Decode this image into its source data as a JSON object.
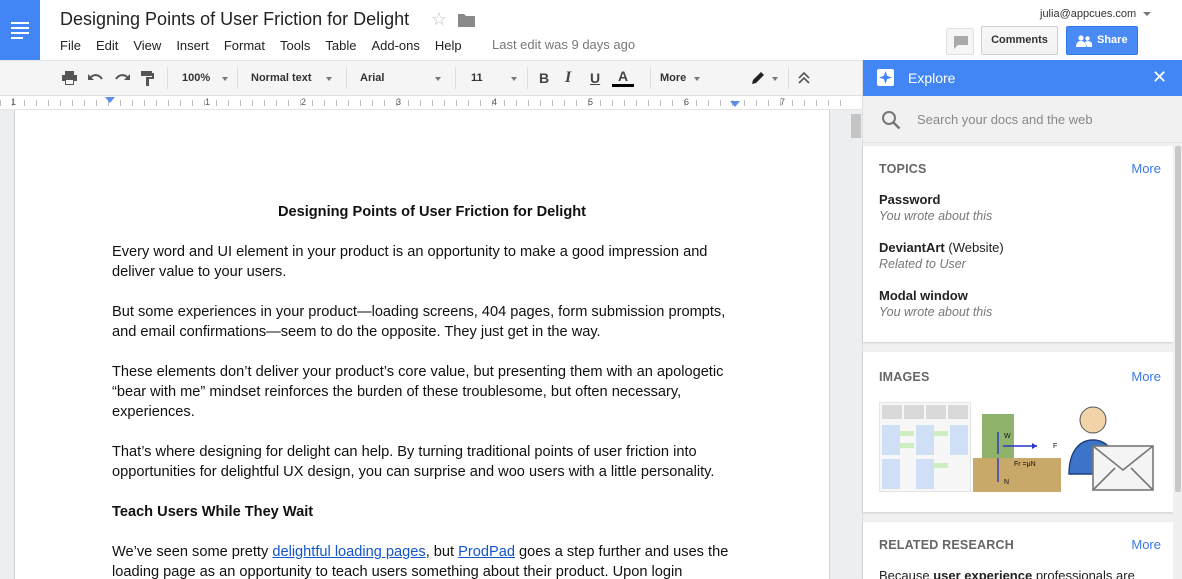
{
  "app": {
    "doc_title": "Designing Points of User Friction for Delight",
    "account": "julia@appcues.com",
    "last_edit": "Last edit was 9 days ago",
    "menu": [
      "File",
      "Edit",
      "View",
      "Insert",
      "Format",
      "Tools",
      "Table",
      "Add-ons",
      "Help"
    ],
    "comments_label": "Comments",
    "share_label": "Share"
  },
  "toolbar": {
    "zoom": "100%",
    "style": "Normal text",
    "font": "Arial",
    "size": "11",
    "bold": "B",
    "italic": "I",
    "underline": "U",
    "text_color": "A",
    "more": "More"
  },
  "ruler": {
    "numbers": [
      "1",
      "1",
      "2",
      "3",
      "4",
      "5",
      "6",
      "7"
    ]
  },
  "document": {
    "heading": "Designing Points of User Friction for Delight",
    "paragraphs": [
      "Every word and UI element in your product is an opportunity to make a good impression and deliver value to your users.",
      "But some experiences in your product—loading screens, 404 pages, form submission prompts, and email confirmations—seem to do the opposite. They just get in the way.",
      "These elements don’t deliver your product’s core value, but presenting them with an apologetic “bear with me” mindset reinforces the burden of these troublesome, but often necessary, experiences.",
      "That’s where designing for delight can help. By turning traditional points of user friction into opportunities for delightful UX design, you can surprise and woo users with a little personality."
    ],
    "subheading": "Teach Users While They Wait",
    "last_para": {
      "pre": "We’ve seen some pretty ",
      "link1": "delightful loading pages",
      "mid": ", but ",
      "link2": "ProdPad",
      "post": " goes a step further and uses the loading page as an opportunity to teach users something about their product. Upon login"
    }
  },
  "explore": {
    "title": "Explore",
    "search_placeholder": "Search your docs and the web",
    "topics": {
      "title": "TOPICS",
      "more": "More",
      "items": [
        {
          "name": "Password",
          "suffix": "",
          "desc": "You wrote about this"
        },
        {
          "name": "DeviantArt",
          "suffix": " (Website)",
          "desc": "Related to User"
        },
        {
          "name": "Modal window",
          "suffix": "",
          "desc": "You wrote about this"
        }
      ]
    },
    "images": {
      "title": "IMAGES",
      "more": "More"
    },
    "research": {
      "title": "RELATED RESEARCH",
      "more": "More",
      "snippet_pre": "Because ",
      "snippet_bold": "user experience",
      "snippet_post": " professionals are"
    }
  },
  "colors": {
    "brand_blue": "#4285f4",
    "link": "#1155cc",
    "share": "#4a8af4"
  }
}
